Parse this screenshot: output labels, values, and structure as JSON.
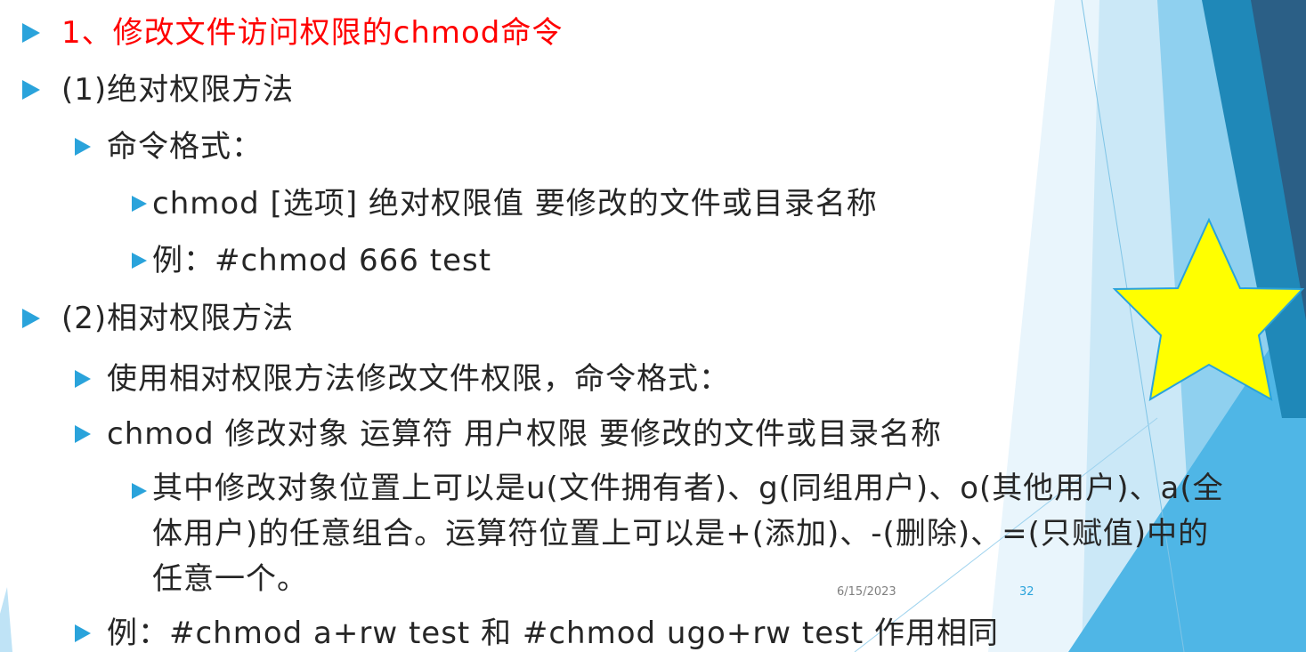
{
  "slide": {
    "title": "1、修改文件访问权限的chmod命令",
    "lines": [
      "(1)绝对权限方法",
      "命令格式：",
      "chmod  [选项] 绝对权限值  要修改的文件或目录名称",
      "例：#chmod  666  test",
      "(2)相对权限方法",
      "使用相对权限方法修改文件权限，命令格式：",
      "chmod  修改对象 运算符 用户权限  要修改的文件或目录名称",
      "其中修改对象位置上可以是u(文件拥有者)、g(同组用户)、o(其他用户)、a(全体用户)的任意组合。运算符位置上可以是+(添加)、-(删除)、=(只赋值)中的任意一个。",
      "例：#chmod  a+rw  test  和  #chmod  ugo+rw  test 作用相同"
    ]
  },
  "footer": {
    "date": "6/15/2023",
    "page": "32"
  },
  "colors": {
    "accent": "#2aa3db",
    "title": "#ff0000",
    "star_fill": "#ffff00",
    "star_stroke": "#2aa3db"
  }
}
